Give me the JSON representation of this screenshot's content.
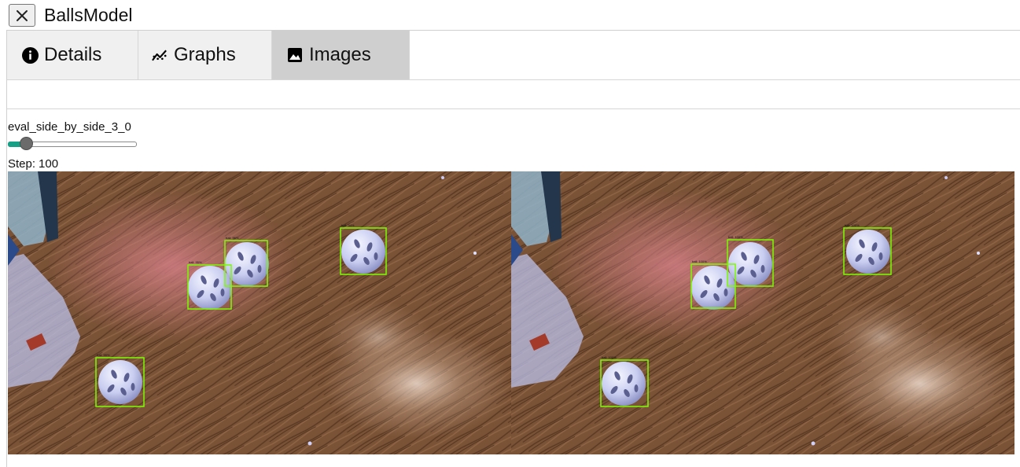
{
  "app": {
    "title": "BallsModel",
    "close_icon": "close-icon"
  },
  "tabs": [
    {
      "label": "Details",
      "icon": "info-icon",
      "active": false
    },
    {
      "label": "Graphs",
      "icon": "graph-icon",
      "active": false
    },
    {
      "label": "Images",
      "icon": "image-icon",
      "active": true
    }
  ],
  "image_panel": {
    "name": "eval_side_by_side_3_0",
    "slider_value_fraction": 0.08,
    "step_label": "Step:",
    "step_value": "100"
  },
  "colors": {
    "accent": "#16a085",
    "active_tab": "#cfcfcf",
    "inactive_tab": "#f0f0f0",
    "detection_box": "#7cfc00"
  },
  "detections": {
    "left_panel": [
      "ball: 96%",
      "ball: 95%",
      "ball: 94%",
      "ball: 99%"
    ],
    "right_panel": [
      "ball: 100%",
      "ball: 100%",
      "ball: 100%",
      "ball: 100%"
    ]
  }
}
